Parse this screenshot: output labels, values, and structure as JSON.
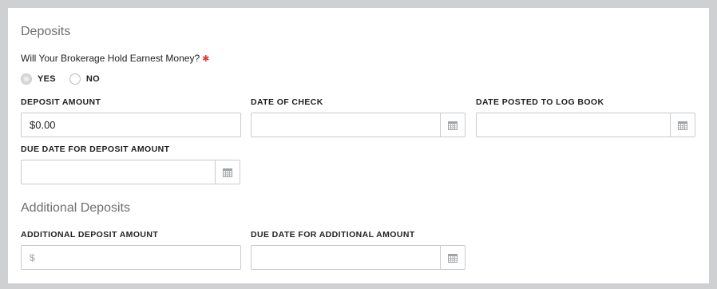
{
  "deposits": {
    "title": "Deposits",
    "question": "Will Your Brokerage Hold Earnest Money?",
    "required_mark": "✱",
    "options": [
      {
        "label": "YES",
        "checked": true
      },
      {
        "label": "NO",
        "checked": false
      }
    ],
    "fields": {
      "deposit_amount": {
        "label": "DEPOSIT AMOUNT",
        "value": "$0.00"
      },
      "date_of_check": {
        "label": "DATE OF CHECK",
        "value": ""
      },
      "date_posted": {
        "label": "DATE POSTED TO LOG BOOK",
        "value": ""
      },
      "due_date": {
        "label": "DUE DATE FOR DEPOSIT AMOUNT",
        "value": ""
      }
    }
  },
  "additional": {
    "title": "Additional Deposits",
    "fields": {
      "amount": {
        "label": "ADDITIONAL DEPOSIT AMOUNT",
        "placeholder": "$"
      },
      "due_date": {
        "label": "DUE DATE FOR ADDITIONAL AMOUNT",
        "value": ""
      }
    }
  },
  "icons": {
    "calendar": "calendar-icon"
  },
  "colors": {
    "required": "#e53935",
    "icon": "#9ea3a8",
    "border": "#c9cbce"
  }
}
